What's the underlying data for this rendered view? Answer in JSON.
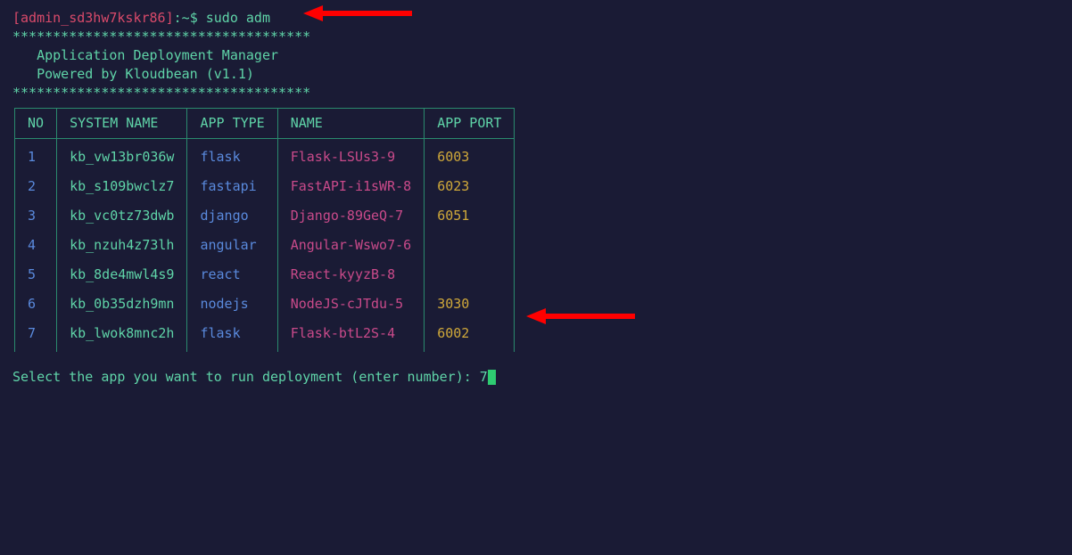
{
  "prompt": {
    "open_bracket": "[",
    "user": "admin_sd3hw7kskr86",
    "close_bracket": "]",
    "sep": ":",
    "cwd": "~",
    "sigil": "$",
    "command": "sudo adm"
  },
  "banner": {
    "stars": "*************************************",
    "line1": "   Application Deployment Manager",
    "line2": "   Powered by Kloudbean (v1.1)"
  },
  "table": {
    "headers": {
      "no": "NO",
      "system": "SYSTEM NAME",
      "apptype": "APP TYPE",
      "name": "NAME",
      "port": "APP PORT"
    },
    "rows": [
      {
        "no": "1",
        "system": "kb_vw13br036w",
        "apptype": "flask",
        "name": "Flask-LSUs3-9",
        "port": "6003"
      },
      {
        "no": "2",
        "system": "kb_s109bwclz7",
        "apptype": "fastapi",
        "name": "FastAPI-i1sWR-8",
        "port": "6023"
      },
      {
        "no": "3",
        "system": "kb_vc0tz73dwb",
        "apptype": "django",
        "name": "Django-89GeQ-7",
        "port": "6051"
      },
      {
        "no": "4",
        "system": "kb_nzuh4z73lh",
        "apptype": "angular",
        "name": "Angular-Wswo7-6",
        "port": ""
      },
      {
        "no": "5",
        "system": "kb_8de4mwl4s9",
        "apptype": "react",
        "name": "React-kyyzB-8",
        "port": ""
      },
      {
        "no": "6",
        "system": "kb_0b35dzh9mn",
        "apptype": "nodejs",
        "name": "NodeJS-cJTdu-5",
        "port": "3030"
      },
      {
        "no": "7",
        "system": "kb_lwok8mnc2h",
        "apptype": "flask",
        "name": "Flask-btL2S-4",
        "port": "6002"
      }
    ]
  },
  "select": {
    "prompt_text": "Select the app you want to run deployment (enter number): ",
    "input_value": "7"
  }
}
